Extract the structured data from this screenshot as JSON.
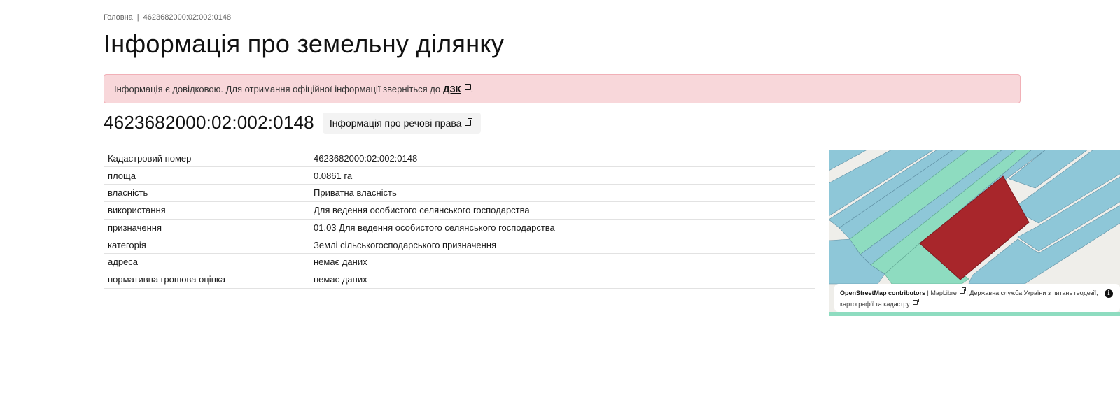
{
  "breadcrumb": {
    "home": "Головна",
    "separator": "|",
    "current": "4623682000:02:002:0148"
  },
  "page_title": "Інформація про земельну ділянку",
  "alert": {
    "text": "Інформація є довідковою. Для отримання офіційної інформації зверніться до",
    "link_label": "ДЗК",
    "suffix": "."
  },
  "parcel": {
    "cadastral_number": "4623682000:02:002:0148",
    "rights_button_label": "Інформація про речові права"
  },
  "details": [
    {
      "key": "Кадастровий номер",
      "value": "4623682000:02:002:0148"
    },
    {
      "key": "площа",
      "value": "0.0861 га"
    },
    {
      "key": "власність",
      "value": "Приватна власність"
    },
    {
      "key": "використання",
      "value": "Для ведення особистого селянського господарства"
    },
    {
      "key": "призначення",
      "value": "01.03 Для ведення особистого селянського господарства"
    },
    {
      "key": "категорія",
      "value": "Землі сільськогосподарського призначення"
    },
    {
      "key": "адреса",
      "value": "немає даних"
    },
    {
      "key": "нормативна грошова оцінка",
      "value": "немає даних"
    }
  ],
  "map": {
    "attribution_osm": "OpenStreetMap contributors",
    "attribution_sep": "|",
    "attribution_maplibre": "MapLibre",
    "attribution_agency": "Державна служба України з питань геодезії, картографії та кадастру",
    "info_icon": "info-icon",
    "colors": {
      "selected_parcel": "#a8262b",
      "private_parcel": "#8ec7d8",
      "other_parcel": "#8edcc0",
      "background": "#efeeea"
    }
  }
}
